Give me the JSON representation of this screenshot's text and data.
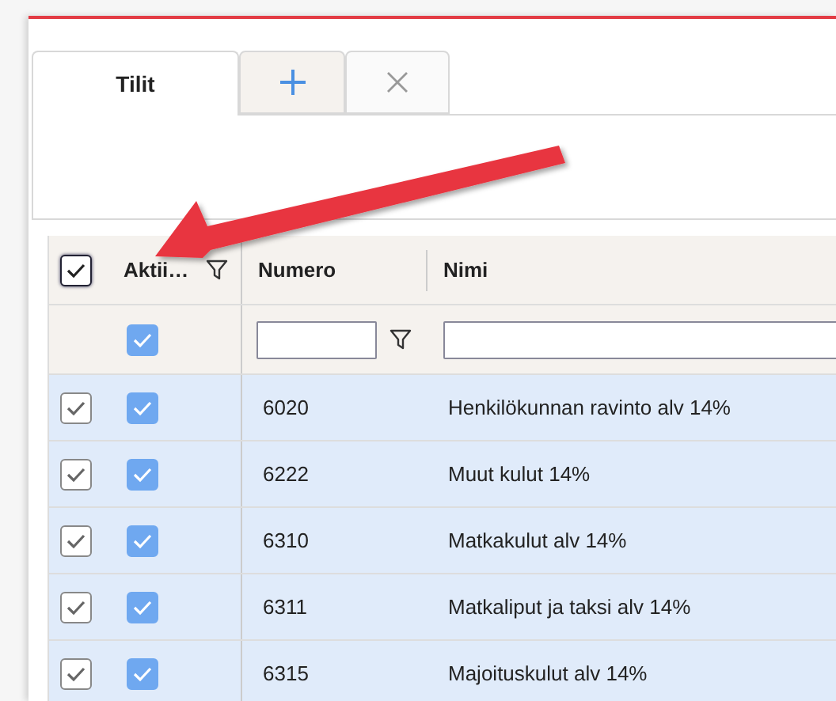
{
  "tabs": [
    {
      "kind": "text",
      "label": "Tilit",
      "selected": true
    },
    {
      "kind": "add",
      "selected": false
    },
    {
      "kind": "close",
      "selected": false
    }
  ],
  "grid": {
    "select_all": {
      "checked": true
    },
    "columns": [
      {
        "label": "Aktii…",
        "filter_icon": true
      },
      {
        "label": "Numero",
        "filter_icon": false
      },
      {
        "label": "Nimi",
        "filter_icon": false
      }
    ],
    "filters": {
      "active_checked": true
    },
    "rows": [
      {
        "selected": true,
        "active": true,
        "number": "6020",
        "name": "Henkilökunnan ravinto alv 14%"
      },
      {
        "selected": true,
        "active": true,
        "number": "6222",
        "name": "Muut kulut 14%"
      },
      {
        "selected": true,
        "active": true,
        "number": "6310",
        "name": "Matkakulut alv 14%"
      },
      {
        "selected": true,
        "active": true,
        "number": "6311",
        "name": "Matkaliput ja taksi alv 14%"
      },
      {
        "selected": true,
        "active": true,
        "number": "6315",
        "name": "Majoituskulut alv 14%"
      }
    ]
  }
}
